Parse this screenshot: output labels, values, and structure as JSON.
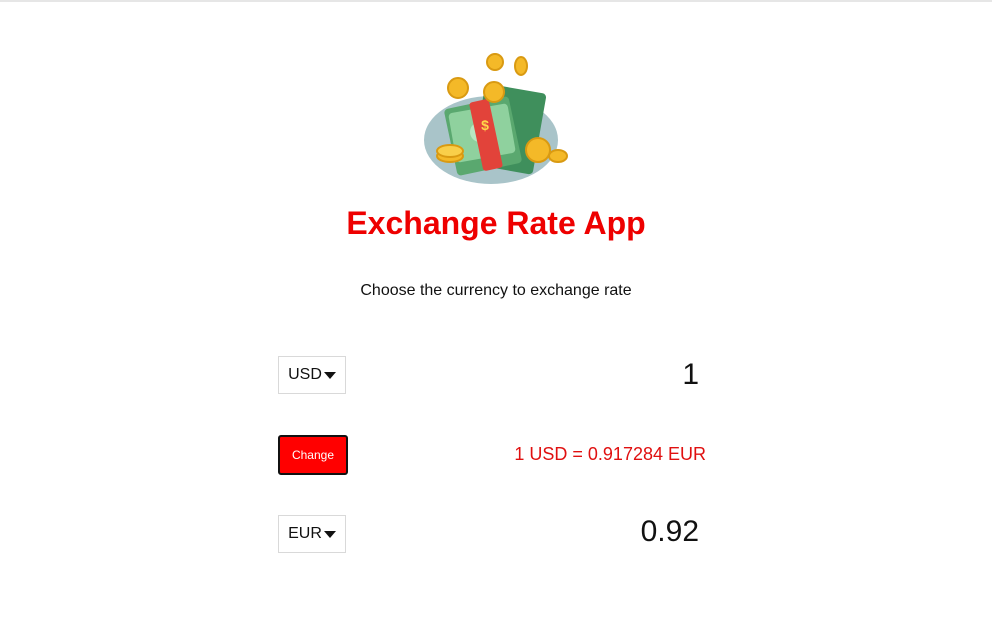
{
  "app": {
    "title": "Exchange Rate App",
    "subtitle": "Choose the currency to exchange rate"
  },
  "from": {
    "currency": "USD",
    "amount": "1"
  },
  "to": {
    "currency": "EUR",
    "amount": "0.92"
  },
  "swap_button": {
    "label": "Change"
  },
  "rate": {
    "text": "1 USD = 0.917284 EUR"
  },
  "icons": {
    "hero": "money-illustration-icon",
    "dropdown": "caret-down-icon"
  },
  "colors": {
    "accent": "#ee0000",
    "button": "#ff0000"
  }
}
